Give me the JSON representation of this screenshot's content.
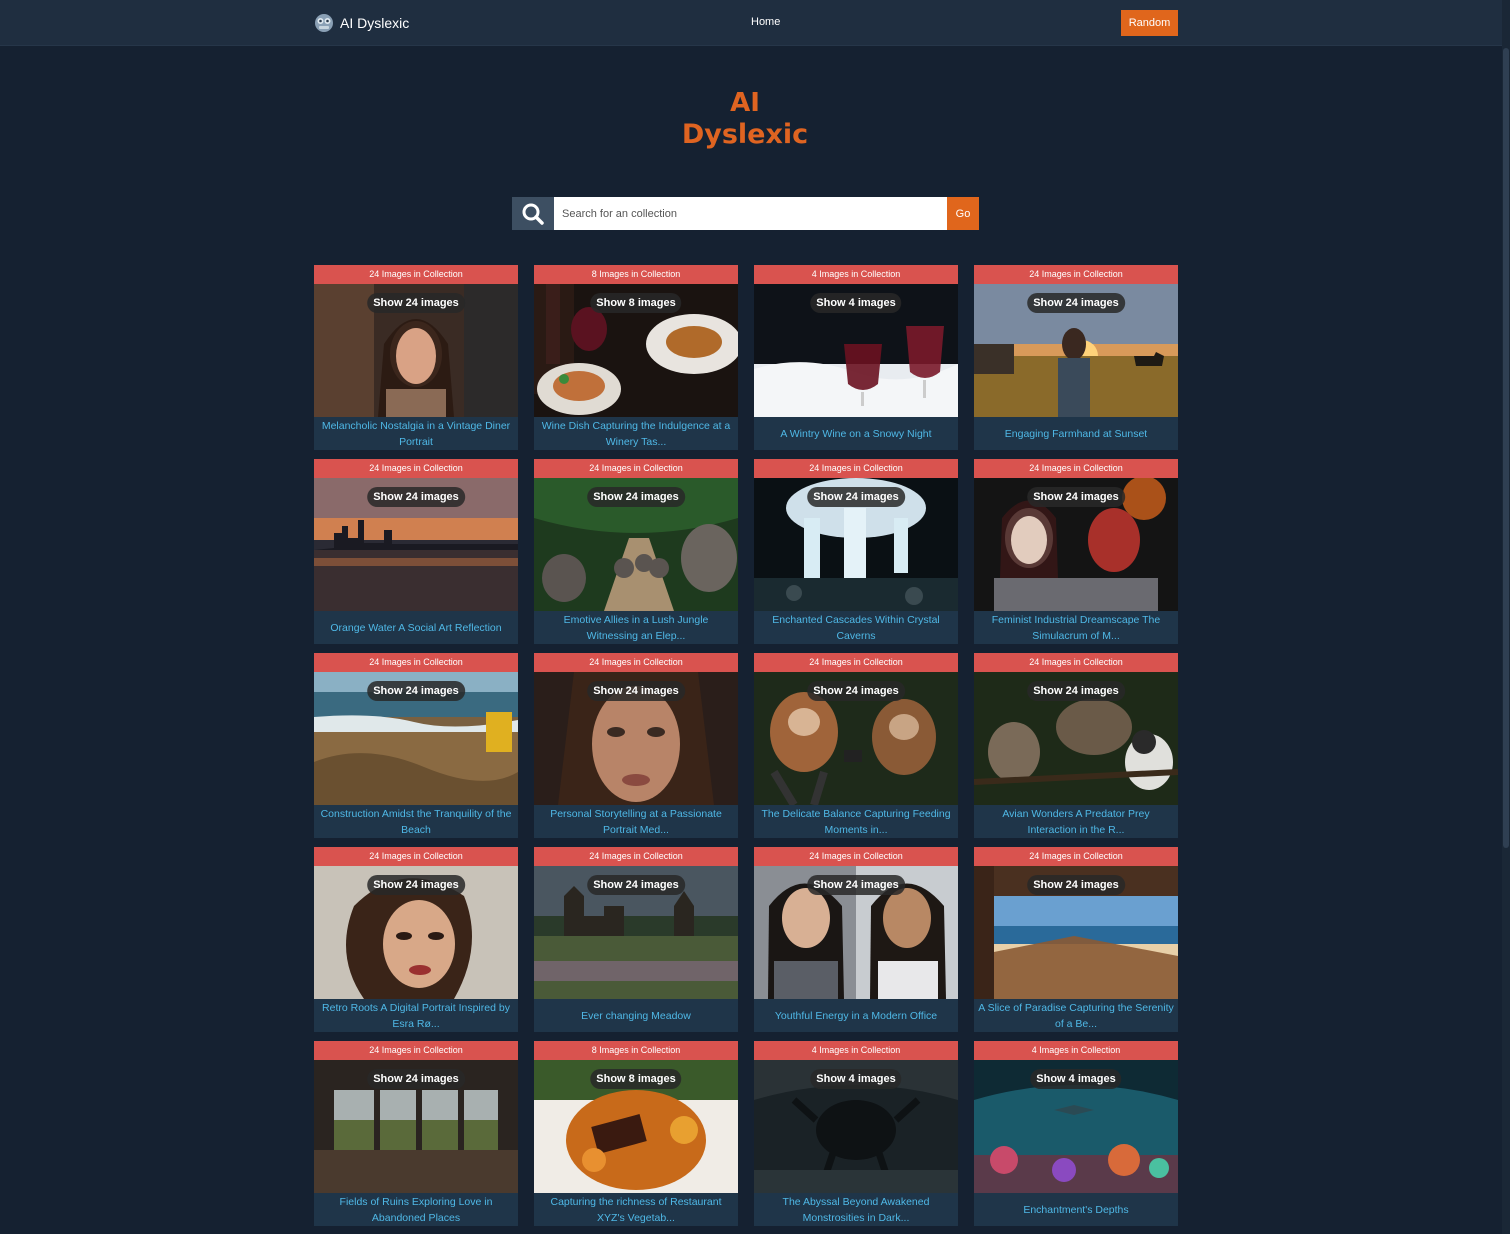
{
  "navbar": {
    "brand": "AI Dyslexic",
    "brand_icon": "robot-logo-icon",
    "home": "Home",
    "random": "Random"
  },
  "hero": {
    "line1": "AI",
    "line2": "Dyslexic"
  },
  "search": {
    "placeholder": "Search for an collection",
    "go": "Go",
    "icon": "search-icon"
  },
  "collections": [
    {
      "count": "24 Images in Collection",
      "show": "Show 24 images",
      "title": "Melancholic Nostalgia in a Vintage Diner Portrait",
      "scene": "portrait-woman"
    },
    {
      "count": "8 Images in Collection",
      "show": "Show 8 images",
      "title": "Wine Dish Capturing the Indulgence at a Winery Tas...",
      "scene": "wine-dinner"
    },
    {
      "count": "4 Images in Collection",
      "show": "Show 4 images",
      "title": "A Wintry Wine on a Snowy Night",
      "scene": "snowy-wine"
    },
    {
      "count": "24 Images in Collection",
      "show": "Show 24 images",
      "title": "Engaging Farmhand at Sunset",
      "scene": "farm-sunset"
    },
    {
      "count": "24 Images in Collection",
      "show": "Show 24 images",
      "title": "Orange Water A Social Art Reflection",
      "scene": "city-sunset"
    },
    {
      "count": "24 Images in Collection",
      "show": "Show 24 images",
      "title": "Emotive Allies in a Lush Jungle Witnessing an Elep...",
      "scene": "jungle-elephants"
    },
    {
      "count": "24 Images in Collection",
      "show": "Show 24 images",
      "title": "Enchanted Cascades Within Crystal Caverns",
      "scene": "cave-waterfall"
    },
    {
      "count": "24 Images in Collection",
      "show": "Show 24 images",
      "title": "Feminist Industrial Dreamscape The Simulacrum of M...",
      "scene": "cyborg-women"
    },
    {
      "count": "24 Images in Collection",
      "show": "Show 24 images",
      "title": "Construction Amidst the Tranquility of the Beach",
      "scene": "beach-construction"
    },
    {
      "count": "24 Images in Collection",
      "show": "Show 24 images",
      "title": "Personal Storytelling at a Passionate Portrait Med...",
      "scene": "closeup-woman"
    },
    {
      "count": "24 Images in Collection",
      "show": "Show 24 images",
      "title": "The Delicate Balance Capturing Feeding Moments in...",
      "scene": "lemurs"
    },
    {
      "count": "24 Images in Collection",
      "show": "Show 24 images",
      "title": "Avian Wonders A Predator Prey Interaction in the R...",
      "scene": "birds"
    },
    {
      "count": "24 Images in Collection",
      "show": "Show 24 images",
      "title": "Retro Roots A Digital Portrait Inspired by Esra Rø...",
      "scene": "retro-portrait"
    },
    {
      "count": "24 Images in Collection",
      "show": "Show 24 images",
      "title": "Ever changing Meadow",
      "scene": "castle-meadow"
    },
    {
      "count": "24 Images in Collection",
      "show": "Show 24 images",
      "title": "Youthful Energy in a Modern Office",
      "scene": "office-women"
    },
    {
      "count": "24 Images in Collection",
      "show": "Show 24 images",
      "title": "A Slice of Paradise Capturing the Serenity of a Be...",
      "scene": "beach-porch"
    },
    {
      "count": "24 Images in Collection",
      "show": "Show 24 images",
      "title": "Fields of Ruins Exploring Love in Abandoned Places",
      "scene": "abandoned-room"
    },
    {
      "count": "8 Images in Collection",
      "show": "Show 8 images",
      "title": "Capturing the richness of Restaurant XYZ's Vegetab...",
      "scene": "vegetable-dish"
    },
    {
      "count": "4 Images in Collection",
      "show": "Show 4 images",
      "title": "The Abyssal Beyond Awakened Monstrosities in Dark...",
      "scene": "dark-monster"
    },
    {
      "count": "4 Images in Collection",
      "show": "Show 4 images",
      "title": "Enchantment's Depths",
      "scene": "underwater-reef"
    }
  ]
}
